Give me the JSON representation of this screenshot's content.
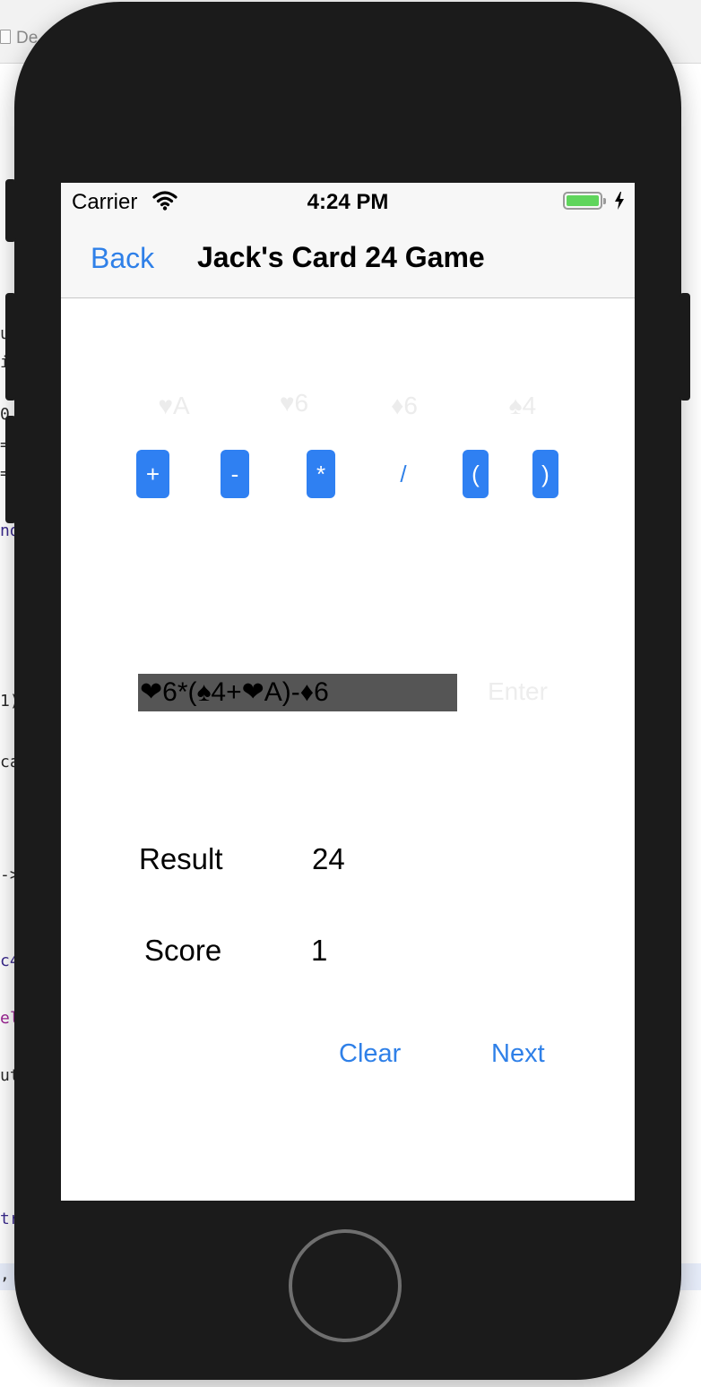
{
  "background": {
    "tab_label": "De",
    "code_fragments": [
      "ul",
      "i:",
      "0",
      "=",
      "=",
      "nd",
      "1)",
      "ca",
      "->",
      "c4",
      "el",
      "ut",
      "tr",
      ","
    ]
  },
  "status_bar": {
    "carrier": "Carrier",
    "time": "4:24 PM",
    "battery_color": "#5fd55c"
  },
  "nav": {
    "back_label": "Back",
    "title": "Jack's Card 24 Game"
  },
  "cards": [
    {
      "label": "♥A"
    },
    {
      "label": "♥6"
    },
    {
      "label": "♦6"
    },
    {
      "label": "♠4"
    }
  ],
  "operators": [
    "+",
    "-",
    "*",
    "/",
    "(",
    ")"
  ],
  "expression": {
    "value": "❤6*(♠4+❤A)-♦6",
    "enter_label": "Enter"
  },
  "result": {
    "label": "Result",
    "value": "24"
  },
  "score": {
    "label": "Score",
    "value": "1"
  },
  "actions": {
    "clear_label": "Clear",
    "next_label": "Next"
  },
  "accent_color": "#2f80e8"
}
